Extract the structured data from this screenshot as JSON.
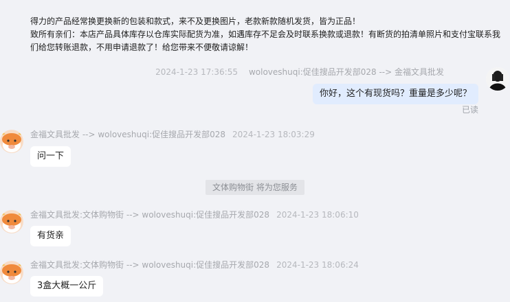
{
  "notice": {
    "line1": "得力的产品经常换更换新的包装和款式，来不及更换图片，老款新款随机发货，皆为正品！",
    "line2": "致所有亲们：本店产品具体库存以仓库实际配货为准，如遇库存不足会及时联系换款或退款！有断货的拍清单照片和支付宝联系我们给您转账退款，不用申请退款了！给您带来不便敬请谅解！"
  },
  "messages": [
    {
      "direction": "outgoing",
      "time": "2024-1-23 17:36:55",
      "route": "woloveshuqi:促佳搜品开发部028 --> 金福文具批发",
      "text": "你好，这个有现货吗？重量是多少呢？",
      "status": "已读"
    },
    {
      "direction": "incoming",
      "route": "金福文具批发 --> woloveshuqi:促佳搜品开发部028",
      "time": "2024-1-23 18:03:29",
      "text": "问一下"
    },
    {
      "direction": "incoming",
      "route": "金福文具批发:文体购物街 --> woloveshuqi:促佳搜品开发部028",
      "time": "2024-1-23 18:06:10",
      "text": "有货亲"
    },
    {
      "direction": "incoming",
      "route": "金福文具批发:文体购物街 --> woloveshuqi:促佳搜品开发部028",
      "time": "2024-1-23 18:06:24",
      "text": "3盒大概一公斤"
    }
  ],
  "system_notice": "文体购物街 将为您服务",
  "colors": {
    "background": "#f1f2f6",
    "outgoing_bubble": "#e1ecfe",
    "incoming_bubble": "#ffffff",
    "meta_text": "#a6a8ad"
  },
  "icons": {
    "shop_avatar": "cartoon-cow-avatar",
    "user_avatar": "dark-silhouette-avatar"
  }
}
